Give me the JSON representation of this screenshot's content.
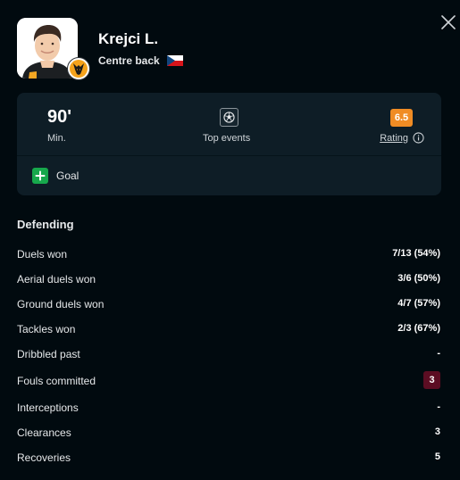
{
  "player": {
    "name": "Krejci L.",
    "position": "Centre back",
    "flag_icon": "czech-flag-icon",
    "team_badge_icon": "wolves-badge-icon"
  },
  "summary": {
    "minutes_value": "90'",
    "minutes_label": "Min.",
    "events_label": "Top events",
    "rating_value": "6.5",
    "rating_label": "Rating",
    "rating_color": "#f08c24"
  },
  "events": [
    {
      "icon": "goal-plus-icon",
      "label": "Goal",
      "color": "#17a84c"
    }
  ],
  "section": {
    "title": "Defending"
  },
  "stats": [
    {
      "label": "Duels won",
      "value": "7/13 (54%)"
    },
    {
      "label": "Aerial duels won",
      "value": "3/6 (50%)"
    },
    {
      "label": "Ground duels won",
      "value": "4/7 (57%)"
    },
    {
      "label": "Tackles won",
      "value": "2/3 (67%)"
    },
    {
      "label": "Dribbled past",
      "value": "-"
    },
    {
      "label": "Fouls committed",
      "value": "3",
      "highlight_color": "#5c0d23"
    },
    {
      "label": "Interceptions",
      "value": "-"
    },
    {
      "label": "Clearances",
      "value": "3"
    },
    {
      "label": "Recoveries",
      "value": "5"
    }
  ]
}
